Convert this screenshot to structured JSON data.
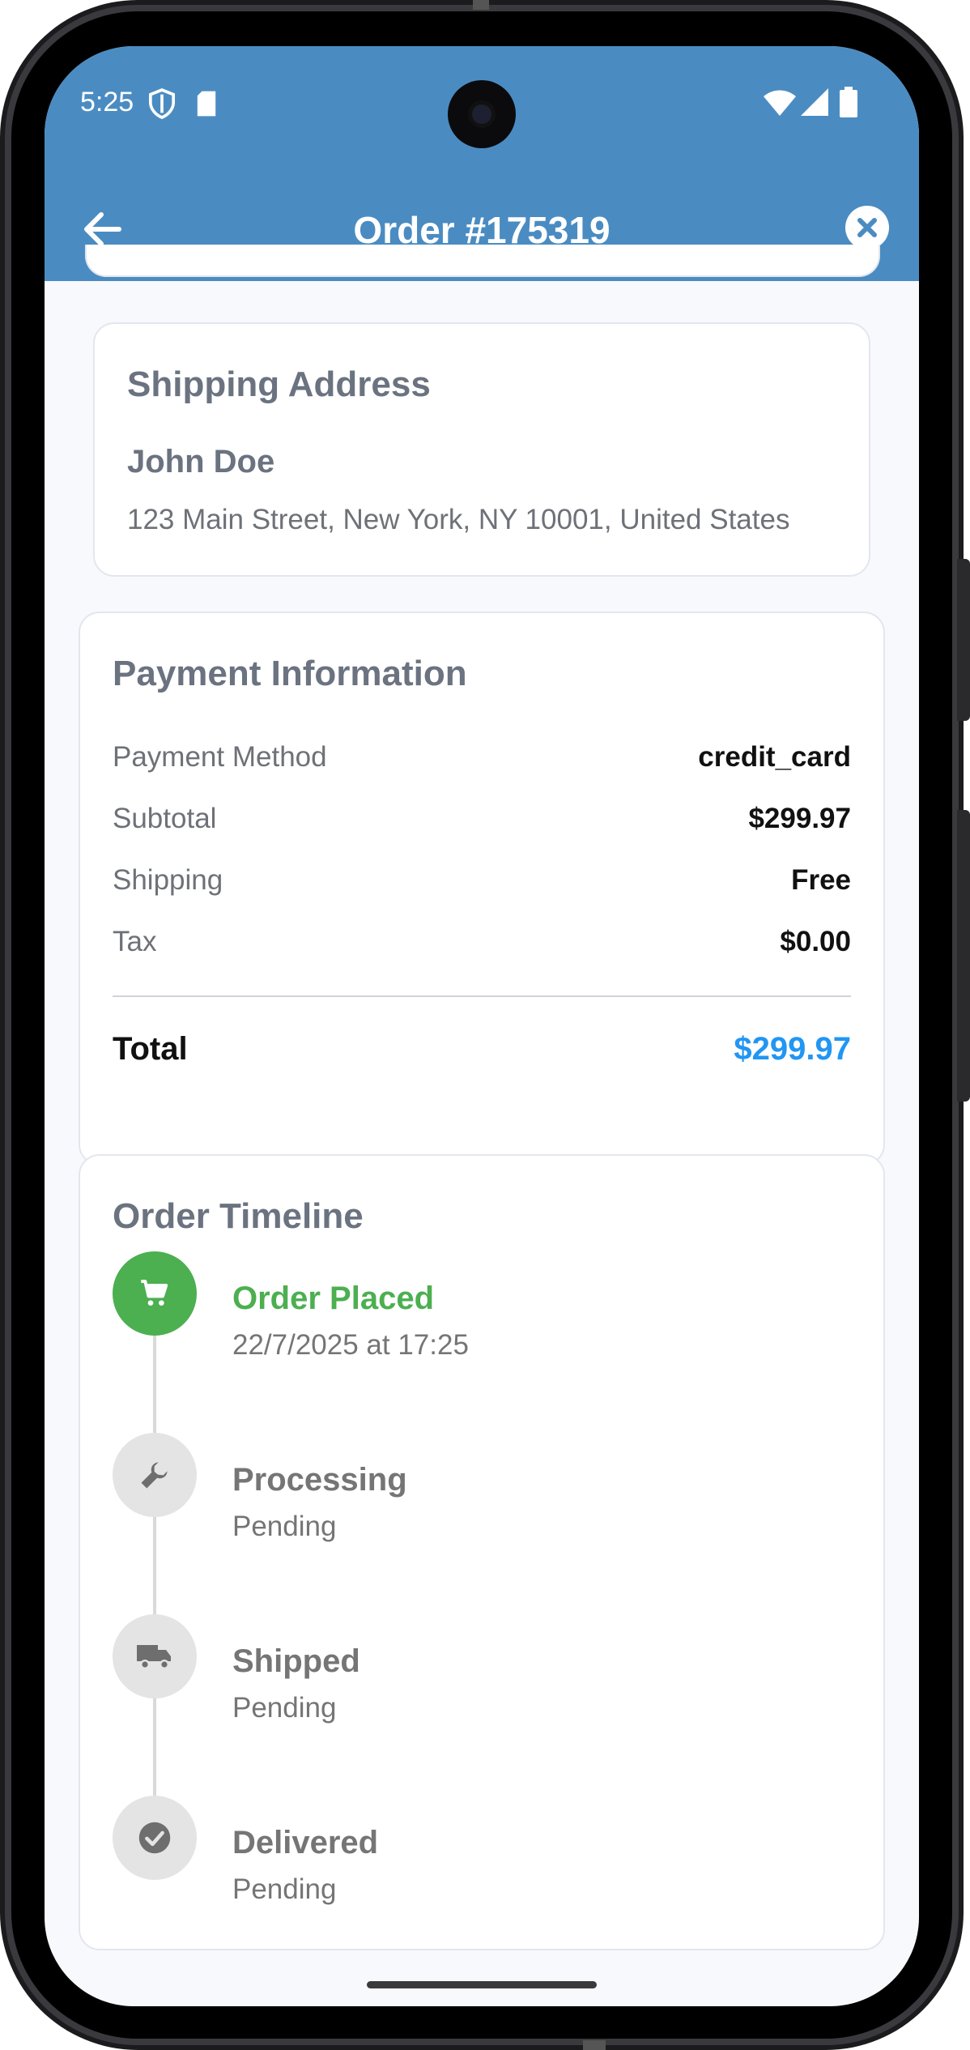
{
  "status_bar": {
    "time": "5:25"
  },
  "app_bar": {
    "title": "Order #175319"
  },
  "shipping": {
    "title": "Shipping Address",
    "name": "John Doe",
    "address": "123 Main Street, New York, NY 10001, United States"
  },
  "payment": {
    "title": "Payment Information",
    "rows": [
      {
        "label": "Payment Method",
        "value": "credit_card"
      },
      {
        "label": "Subtotal",
        "value": "$299.97"
      },
      {
        "label": "Shipping",
        "value": "Free"
      },
      {
        "label": "Tax",
        "value": "$0.00"
      }
    ],
    "total_label": "Total",
    "total_value": "$299.97"
  },
  "timeline": {
    "title": "Order Timeline",
    "steps": [
      {
        "title": "Order Placed",
        "subtitle": "22/7/2025 at 17:25",
        "icon": "cart-icon",
        "completed": true
      },
      {
        "title": "Processing",
        "subtitle": "Pending",
        "icon": "wrench-icon",
        "completed": false
      },
      {
        "title": "Shipped",
        "subtitle": "Pending",
        "icon": "truck-icon",
        "completed": false
      },
      {
        "title": "Delivered",
        "subtitle": "Pending",
        "icon": "check-circle-icon",
        "completed": false
      }
    ]
  },
  "colors": {
    "app_bar": "#4a8cc2",
    "completed": "#4caf50",
    "total": "#2196f3",
    "pending_circle": "#e4e4e4"
  }
}
